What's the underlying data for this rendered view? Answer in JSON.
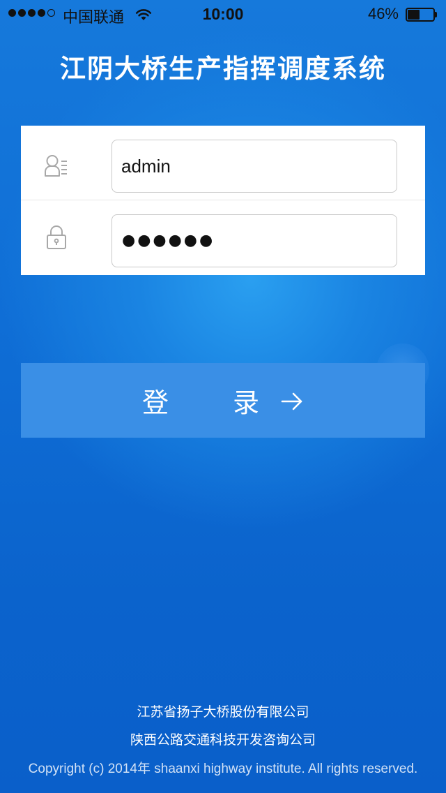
{
  "status_bar": {
    "carrier": "中国联通",
    "time": "10:00",
    "battery_percent": "46%",
    "battery_level": 0.46,
    "signal_bars": 4,
    "signal_max": 5
  },
  "app": {
    "title": "江阴大桥生产指挥调度系统"
  },
  "login_form": {
    "username_value": "admin",
    "password_value": "●●●●●●",
    "user_icon": "user-list-icon",
    "lock_icon": "lock-icon"
  },
  "login_button": {
    "label": "登 录",
    "icon": "arrow-right-icon"
  },
  "footer": {
    "org1": "江苏省扬子大桥股份有限公司",
    "org2": "陕西公路交通科技开发咨询公司",
    "copyright": "Copyright (c) 2014年 shaanxi highway institute. All rights reserved."
  },
  "colors": {
    "background": "#0f6ed6",
    "button": "#3a8fe6",
    "card": "#ffffff",
    "text": "#ffffff"
  }
}
